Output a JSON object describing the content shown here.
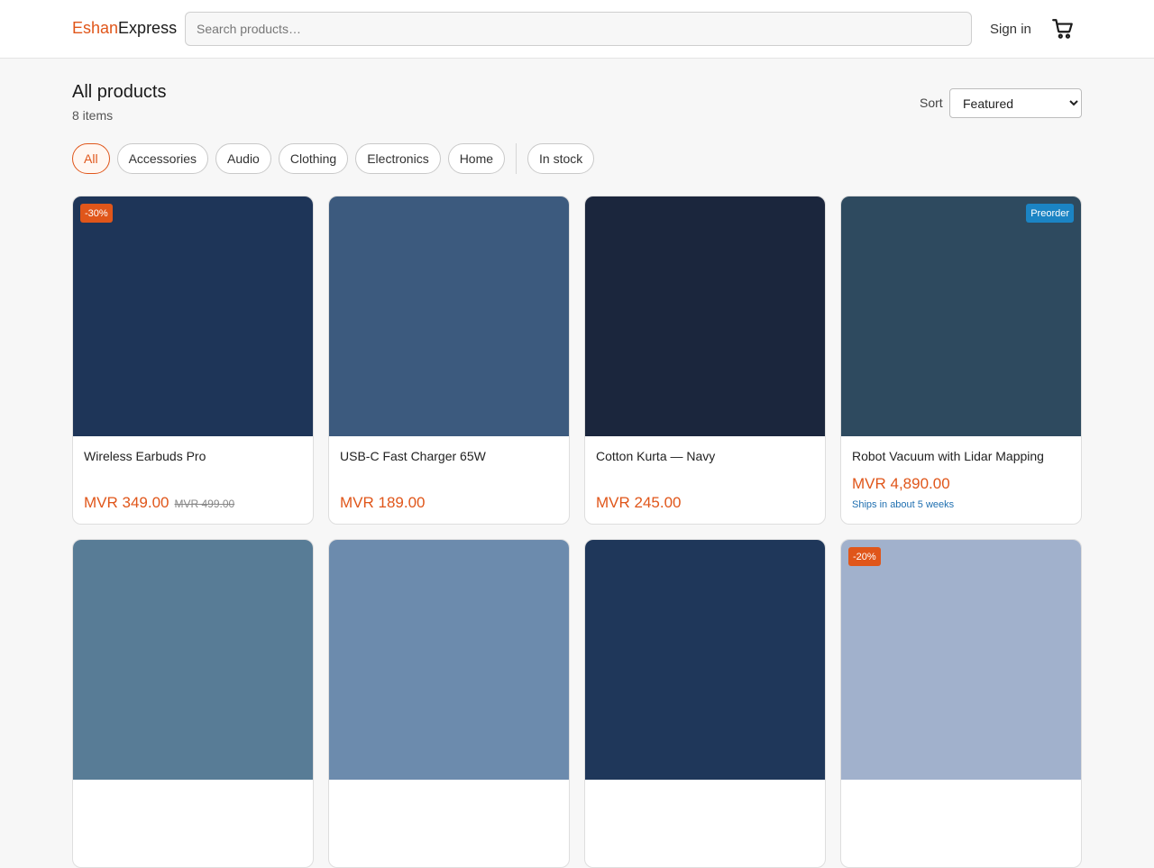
{
  "header": {
    "logo_part1": "Eshan",
    "logo_part2": "Express",
    "search_placeholder": "Search products…",
    "signin_label": "Sign in",
    "cart_icon": "cart-icon"
  },
  "listing": {
    "title": "All products",
    "count": "8 items",
    "sort_label": "Sort",
    "sort_selected": "Featured"
  },
  "filters": {
    "categories": [
      "All",
      "Accessories",
      "Audio",
      "Clothing",
      "Electronics",
      "Home"
    ],
    "active": "All",
    "stock_filter": "In stock"
  },
  "colors": {
    "accent": "#e0561a",
    "preorder_badge": "#1b84c4",
    "discount_badge": "#e0561a"
  },
  "products": [
    {
      "name": "Wireless Earbuds Pro",
      "price": "MVR 349.00",
      "old_price": "MVR 499.00",
      "badge": "-30%",
      "badge_type": "discount",
      "image_color": "#1e3558"
    },
    {
      "name": "USB-C Fast Charger 65W",
      "price": "MVR 189.00",
      "image_color": "#3c5a7e"
    },
    {
      "name": "Cotton Kurta — Navy",
      "price": "MVR 245.00",
      "image_color": "#1b263d"
    },
    {
      "name": "Robot Vacuum with Lidar Mapping",
      "price": "MVR 4,890.00",
      "badge": "Preorder",
      "badge_type": "preorder",
      "ships_note": "Ships in about 5 weeks",
      "image_color": "#2e4a5f"
    },
    {
      "image_color": "#587c96"
    },
    {
      "image_color": "#6c8bad"
    },
    {
      "image_color": "#1f375a"
    },
    {
      "badge": "-20%",
      "badge_type": "discount",
      "image_color": "#a1b1cc"
    }
  ]
}
